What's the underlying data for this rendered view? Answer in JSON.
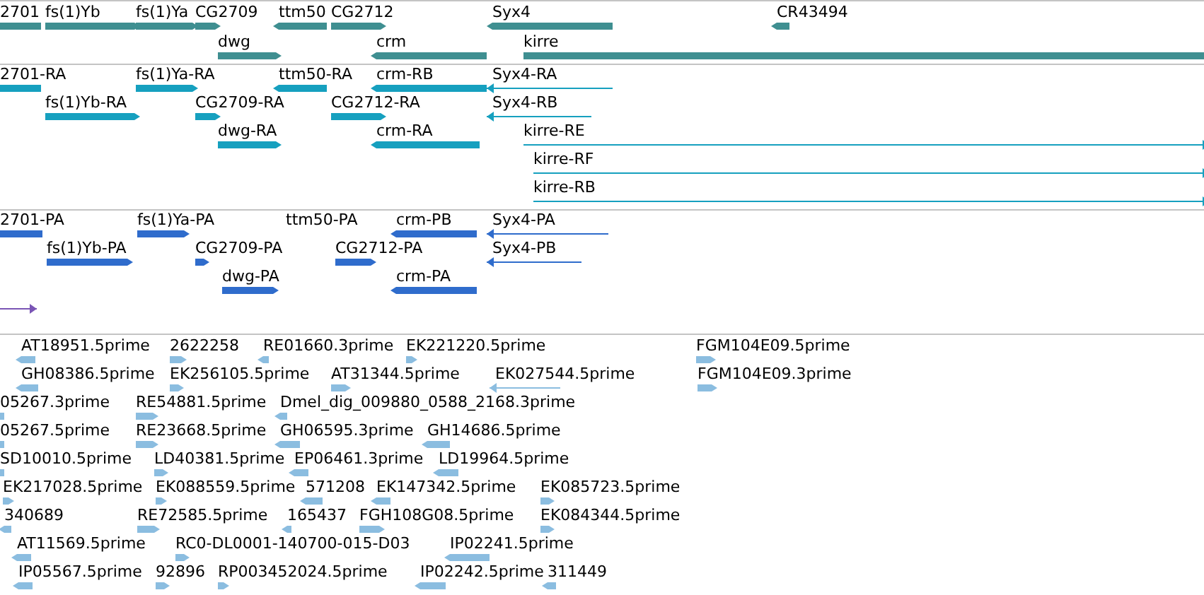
{
  "tracks": [
    {
      "kind": "genes",
      "color": "#3f8f91",
      "features": [
        {
          "label": "2701",
          "reverse": true
        },
        {
          "label": "fs(1)Yb",
          "reverse": false
        },
        {
          "label": "fs(1)Ya",
          "reverse": false
        },
        {
          "label": "CG2709",
          "reverse": false
        },
        {
          "label": "ttm50",
          "reverse": true
        },
        {
          "label": "CG2712",
          "reverse": false
        },
        {
          "label": "Syx4",
          "reverse": true
        },
        {
          "label": "CR43494",
          "reverse": true
        },
        {
          "label": "dwg",
          "reverse": false
        },
        {
          "label": "crm",
          "reverse": true
        },
        {
          "label": "kirre",
          "reverse": false
        }
      ]
    },
    {
      "kind": "transcripts",
      "color": "#16a0bf",
      "features": [
        {
          "label": "2701-RA",
          "reverse": true
        },
        {
          "label": "fs(1)Ya-RA",
          "reverse": false
        },
        {
          "label": "ttm50-RA",
          "reverse": true
        },
        {
          "label": "crm-RB",
          "reverse": true
        },
        {
          "label": "Syx4-RA",
          "reverse": true
        },
        {
          "label": "fs(1)Yb-RA",
          "reverse": false
        },
        {
          "label": "CG2709-RA",
          "reverse": false
        },
        {
          "label": "CG2712-RA",
          "reverse": false
        },
        {
          "label": "Syx4-RB",
          "reverse": true
        },
        {
          "label": "dwg-RA",
          "reverse": false
        },
        {
          "label": "crm-RA",
          "reverse": true
        },
        {
          "label": "kirre-RE",
          "reverse": false
        },
        {
          "label": "kirre-RF",
          "reverse": false
        },
        {
          "label": "kirre-RB",
          "reverse": false
        }
      ]
    },
    {
      "kind": "proteins",
      "color": "#2f6ccc",
      "features": [
        {
          "label": "2701-PA",
          "reverse": true
        },
        {
          "label": "fs(1)Ya-PA",
          "reverse": false
        },
        {
          "label": "ttm50-PA"
        },
        {
          "label": "crm-PB",
          "reverse": true
        },
        {
          "label": "Syx4-PA",
          "reverse": true
        },
        {
          "label": "fs(1)Yb-PA",
          "reverse": false
        },
        {
          "label": "CG2709-PA",
          "reverse": false
        },
        {
          "label": "CG2712-PA",
          "reverse": false
        },
        {
          "label": "Syx4-PB",
          "reverse": true
        },
        {
          "label": "dwg-PA",
          "reverse": false
        },
        {
          "label": "crm-PA",
          "reverse": true
        }
      ]
    },
    {
      "kind": "other",
      "color": "#7a55b5",
      "features": [
        {
          "reverse": false
        }
      ]
    },
    {
      "kind": "ests",
      "color": "#8bbde0",
      "features": [
        {
          "label": "AT18951.5prime",
          "reverse": true
        },
        {
          "label": "2622258",
          "reverse": false
        },
        {
          "label": "RE01660.3prime",
          "reverse": true
        },
        {
          "label": "EK221220.5prime",
          "reverse": false
        },
        {
          "label": "FGM104E09.5prime",
          "reverse": false
        },
        {
          "label": "GH08386.5prime",
          "reverse": true
        },
        {
          "label": "EK256105.5prime",
          "reverse": false
        },
        {
          "label": "AT31344.5prime",
          "reverse": false
        },
        {
          "label": "EK027544.5prime",
          "reverse": true
        },
        {
          "label": "FGM104E09.3prime",
          "reverse": false
        },
        {
          "label": "05267.3prime",
          "reverse": true
        },
        {
          "label": "RE54881.5prime",
          "reverse": false
        },
        {
          "label": "Dmel_dig_009880_0588_2168.3prime",
          "reverse": true
        },
        {
          "label": "05267.5prime",
          "reverse": true
        },
        {
          "label": "RE23668.5prime",
          "reverse": false
        },
        {
          "label": "GH06595.3prime",
          "reverse": true
        },
        {
          "label": "GH14686.5prime",
          "reverse": true
        },
        {
          "label": "SD10010.5prime",
          "reverse": true
        },
        {
          "label": "LD40381.5prime",
          "reverse": false
        },
        {
          "label": "EP06461.3prime",
          "reverse": true
        },
        {
          "label": "LD19964.5prime",
          "reverse": true
        },
        {
          "label": "EK217028.5prime",
          "reverse": false
        },
        {
          "label": "EK088559.5prime",
          "reverse": false
        },
        {
          "label": "571208",
          "reverse": true
        },
        {
          "label": "EK147342.5prime",
          "reverse": true
        },
        {
          "label": "EK085723.5prime",
          "reverse": false
        },
        {
          "label": "340689",
          "reverse": true
        },
        {
          "label": "RE72585.5prime",
          "reverse": false
        },
        {
          "label": "165437",
          "reverse": true
        },
        {
          "label": "FGH108G08.5prime",
          "reverse": false
        },
        {
          "label": "EK084344.5prime",
          "reverse": false
        },
        {
          "label": "AT11569.5prime",
          "reverse": true
        },
        {
          "label": "RC0-DL0001-140700-015-D03",
          "reverse": false
        },
        {
          "label": "IP02241.5prime",
          "reverse": true
        },
        {
          "label": "IP05567.5prime",
          "reverse": true
        },
        {
          "label": "92896",
          "reverse": false
        },
        {
          "label": "RP003452024.5prime",
          "reverse": false
        },
        {
          "label": "IP02242.5prime",
          "reverse": true
        },
        {
          "label": "311449",
          "reverse": true
        }
      ]
    }
  ]
}
